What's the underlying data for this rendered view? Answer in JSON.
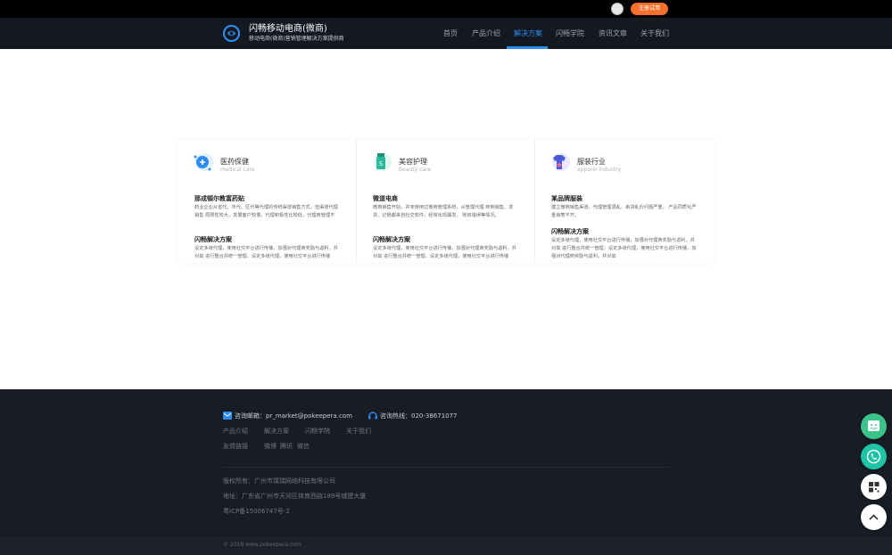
{
  "topbar": {
    "trial_label": "注册试用"
  },
  "header": {
    "brand": "闪畅移动电商(微商)",
    "tagline": "移动电商(微商)营销管理解决方案提供商",
    "nav": [
      {
        "label": "首页",
        "active": false
      },
      {
        "label": "产品介绍",
        "active": false
      },
      {
        "label": "解决方案",
        "active": true
      },
      {
        "label": "闪畅学院",
        "active": false
      },
      {
        "label": "资讯文章",
        "active": false
      },
      {
        "label": "关于我们",
        "active": false
      }
    ]
  },
  "cards": [
    {
      "title": "医药保健",
      "subtitle": "medical care",
      "case_title": "那成頓尔教富药贴",
      "case_text": "药业企业从省代、市代、区代等代理的传统渠道销售方式，但渠道代理销售 局限性较大，发展客户较慢，代理积极性比较低，代理商管理不",
      "solution_title": "闪畅解决方案",
      "solution_text": "设定多级代理，使用社交平台进行传播，加强对代理商奖励与返利，并对其 进行整合并统一管理，设定多级代理，使用社交平台进行传播"
    },
    {
      "title": "美容护理",
      "subtitle": "Beauty care",
      "case_title": "微道电商",
      "case_text": "微商销售开始，并未使用过微商管理系统，从管理代理 商到销售、发货、记账都来自社交软件，经常出现漏发、 账目错误等情况。",
      "solution_title": "闪畅解决方案",
      "solution_text": "设定多级代理，使用社交平台进行传播，加强对代理商奖励与返利，并对其 进行整合并统一管理，设定多级代理，使用社交平台进行传播"
    },
    {
      "title": "服装行业",
      "subtitle": "apparel industry",
      "case_title": "某品牌服装",
      "case_text": "建立微商销售渠道，代理管理混乱，串货乱价问题严重， 产品同质化严重良莠不齐。",
      "solution_title": "闪畅解决方案",
      "solution_text": "设定多级代理，使用社交平台进行传播，加强对代理商奖励与返利，并对其 进行整合并统一管理，设定多级代理，使用社交平台进行传播，加强对代理商奖励与返利，并对其"
    }
  ],
  "footer": {
    "email": "咨询邮箱：pr_market@pokeepera.com",
    "hotline": "咨询热线：020-38671077",
    "links": [
      "产品介绍",
      "解决方案",
      "闪畅学院",
      "关于我们"
    ],
    "friend_label": "友情链接",
    "friend_links": [
      "微博",
      "腾讯",
      "微信"
    ],
    "rights": "版权所有：广州市璞瑞网络科技有限公司",
    "address": "地址：广东省广州市天河区体育西路189号城建大厦",
    "icp": "粤ICP备15006747号-2",
    "copyright": "© 2018 www.pokeepera.com"
  },
  "colors": {
    "accent": "#2e8ef0",
    "trial": "#f36f2b",
    "footer": "#181c25",
    "float_green": "#3cc38a",
    "float_teal": "#1fc4a6"
  },
  "icons": [
    "user-avatar-icon",
    "brand-logo-icon",
    "medical-icon",
    "beauty-icon",
    "apparel-icon",
    "mail-icon",
    "headset-icon",
    "chat-icon",
    "phone-icon",
    "qrcode-icon",
    "arrow-up-icon"
  ]
}
